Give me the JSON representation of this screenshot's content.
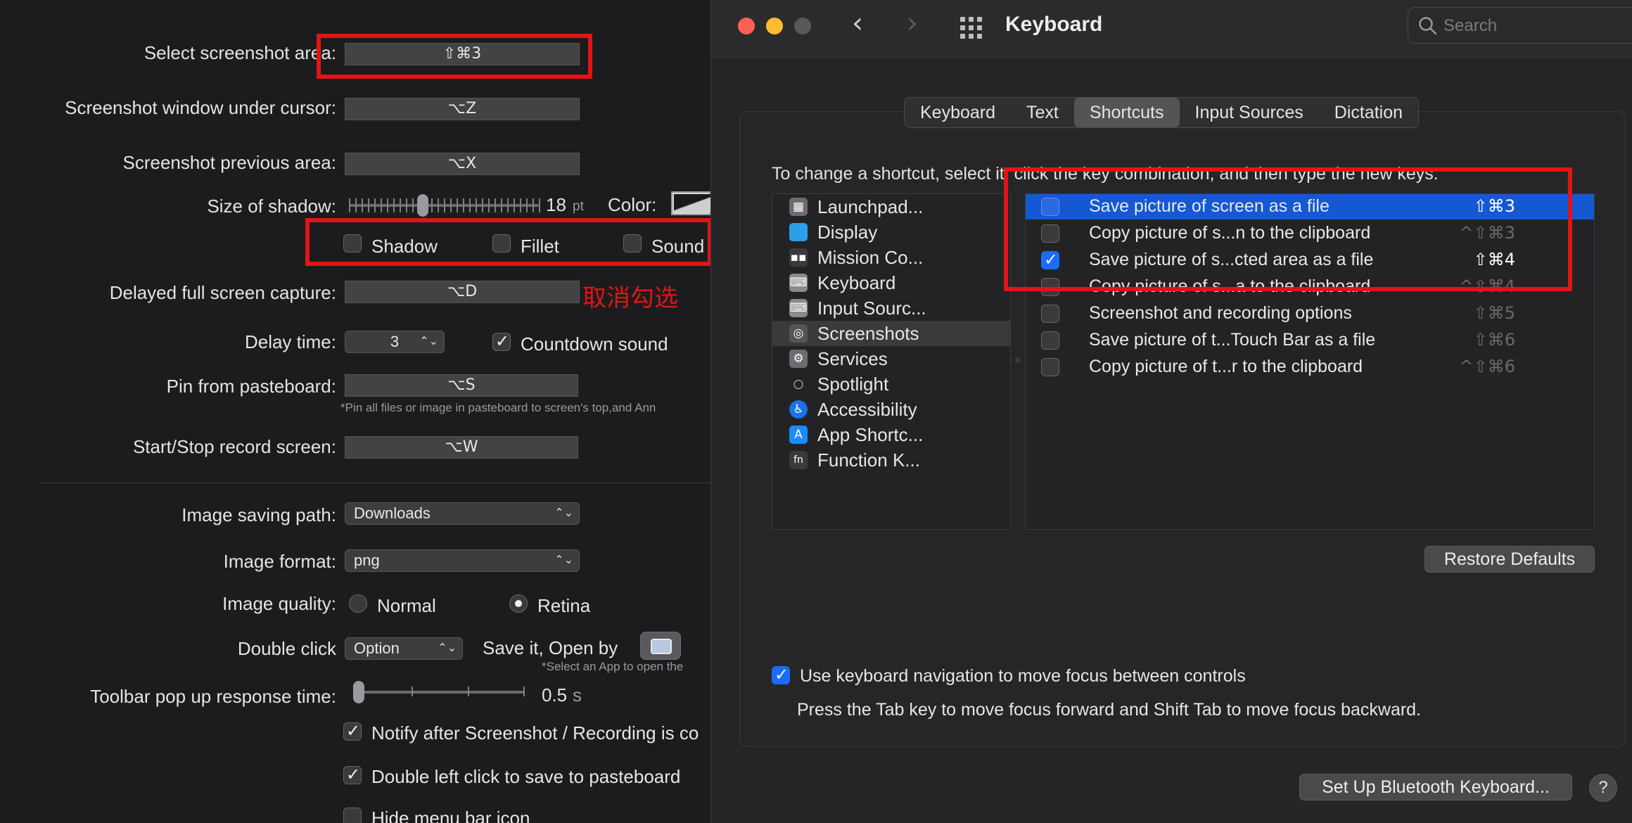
{
  "left": {
    "rows": {
      "select_area": {
        "label": "Select screenshot area:",
        "key": "⇧⌘3"
      },
      "window_cursor": {
        "label": "Screenshot window under cursor:",
        "key": "⌥Z"
      },
      "previous_area": {
        "label": "Screenshot previous area:",
        "key": "⌥X"
      },
      "shadow_size": {
        "label": "Size of shadow:",
        "value": "18",
        "unit": "pt",
        "color_label": "Color:"
      },
      "delayed": {
        "label": "Delayed full screen capture:",
        "key": "⌥D"
      },
      "delay_time": {
        "label": "Delay time:",
        "value": "3",
        "countdown": "Countdown sound"
      },
      "pin": {
        "label": "Pin from pasteboard:",
        "key": "⌥S",
        "note": "*Pin all files or image in pasteboard to screen's top,and Ann"
      },
      "record": {
        "label": "Start/Stop record screen:",
        "key": "⌥W"
      },
      "saving_path": {
        "label": "Image saving path:",
        "value": "Downloads"
      },
      "format": {
        "label": "Image format:",
        "value": "png"
      },
      "quality": {
        "label": "Image quality:",
        "normal": "Normal",
        "retina": "Retina"
      },
      "double_click": {
        "label": "Double click",
        "value": "Option",
        "save_open": "Save it, Open by",
        "note": "*Select an App to open the"
      },
      "toolbar": {
        "label": "Toolbar pop up response time:",
        "value": "0.5",
        "unit": "s"
      }
    },
    "effects": {
      "shadow": "Shadow",
      "fillet": "Fillet",
      "sound": "Sound"
    },
    "annotation": "取消勾选",
    "checks": {
      "notify": "Notify after Screenshot / Recording is co",
      "double_left": "Double left click to save to pasteboard",
      "hide_menu": "Hide menu bar icon"
    },
    "shadow_slider_fraction": 0.38,
    "toolbar_slider_fraction": 0.0
  },
  "window": {
    "title": "Keyboard",
    "search_placeholder": "Search",
    "tabs": [
      "Keyboard",
      "Text",
      "Shortcuts",
      "Input Sources",
      "Dictation"
    ],
    "selected_tab": "Shortcuts",
    "instruction": "To change a shortcut, select it, click the key combination, and then type the new keys.",
    "categories": [
      {
        "label": "Launchpad...",
        "icon": "launchpad-icon"
      },
      {
        "label": "Display",
        "icon": "display-icon"
      },
      {
        "label": "Mission Co...",
        "icon": "mission-control-icon"
      },
      {
        "label": "Keyboard",
        "icon": "keyboard-icon"
      },
      {
        "label": "Input Sourc...",
        "icon": "input-sources-icon"
      },
      {
        "label": "Screenshots",
        "icon": "screenshots-icon"
      },
      {
        "label": "Services",
        "icon": "gear-icon"
      },
      {
        "label": "Spotlight",
        "icon": "spotlight-icon"
      },
      {
        "label": "Accessibility",
        "icon": "accessibility-icon"
      },
      {
        "label": "App Shortc...",
        "icon": "app-store-icon"
      },
      {
        "label": "Function K...",
        "icon": "fn-icon"
      }
    ],
    "selected_category": "Screenshots",
    "shortcuts": [
      {
        "label": "Save picture of screen as a file",
        "keys": "⇧⌘3",
        "checked": false,
        "selected": true,
        "dim": false
      },
      {
        "label": "Copy picture of s...n to the clipboard",
        "keys": "^⇧⌘3",
        "checked": false,
        "selected": false,
        "dim": true
      },
      {
        "label": "Save picture of s...cted area as a file",
        "keys": "⇧⌘4",
        "checked": true,
        "selected": false,
        "dim": false
      },
      {
        "label": "Copy picture of s...a to the clipboard",
        "keys": "^⇧⌘4",
        "checked": false,
        "selected": false,
        "dim": true
      },
      {
        "label": "Screenshot and recording options",
        "keys": "⇧⌘5",
        "checked": false,
        "selected": false,
        "dim": true
      },
      {
        "label": "Save picture of t...Touch Bar as a file",
        "keys": "⇧⌘6",
        "checked": false,
        "selected": false,
        "dim": true
      },
      {
        "label": "Copy picture of t...r to the clipboard",
        "keys": "^⇧⌘6",
        "checked": false,
        "selected": false,
        "dim": true
      }
    ],
    "restore_defaults": "Restore Defaults",
    "keyboard_nav": "Use keyboard navigation to move focus between controls",
    "keyboard_nav_hint": "Press the Tab key to move focus forward and Shift Tab to move focus backward.",
    "bluetooth_button": "Set Up Bluetooth Keyboard...",
    "help": "?"
  },
  "colors": {
    "annotation_red": "#e01515",
    "selection_blue": "#1458d4",
    "accent": "#1a6cff"
  }
}
